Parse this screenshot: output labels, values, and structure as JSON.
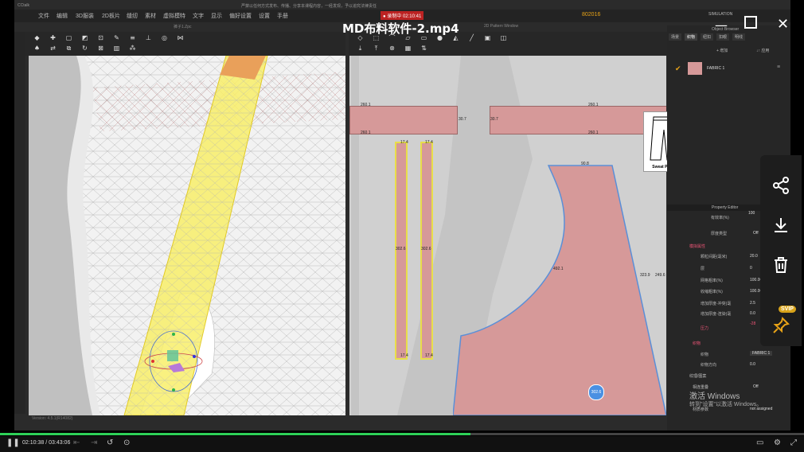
{
  "video": {
    "title": "MD布料软件-2.mp4",
    "record": "● 录制中 02:10:41",
    "brand": "CCtalk",
    "time": "02:10:38 / 03:43:06",
    "progress": 0.585
  },
  "menu": [
    "文件",
    "编辑",
    "3D服装",
    "2D板片",
    "缝纫",
    "素材",
    "虚拟模特",
    "文字",
    "显示",
    "偏好设置",
    "设置",
    "手册"
  ],
  "app": {
    "notice": "严禁以任何方式发布、传播、分享本课程内容，一经发现，予以追究法律责任",
    "sim_label": "SIMULATION",
    "badge": "802016",
    "view3d_title": "裤子1.Zpc",
    "view2d_title": "2D Pattern Window",
    "status_left": "Version: 4.5.1(R14082)"
  },
  "panel": {
    "title": "Object Browser",
    "tabs": [
      "场景",
      "织物",
      "纽扣",
      "扣眼",
      "明线"
    ],
    "add_label": "+ 增加",
    "sort_label": "↓↑ 应用",
    "fabric_name": "FABRIC 1",
    "prop_title": "Property Editor",
    "props": [
      {
        "label": "有效率(%)",
        "value": "100"
      },
      {
        "label": "厚度类型",
        "value": "Off"
      },
      {
        "label": "颗粒间距(毫米)",
        "value": "20.0"
      },
      {
        "label": "层",
        "value": "0"
      },
      {
        "label": "网格粗率(%)",
        "value": "100.00"
      },
      {
        "label": "收缩粗率(%)",
        "value": "100.00"
      },
      {
        "label": "增加厚度-冲突(毫",
        "value": "2.5"
      },
      {
        "label": "增加厚度-渲染(毫",
        "value": "0.0"
      }
    ],
    "sections": [
      "模拟属性",
      "压力",
      "织物",
      "纹理/图案"
    ],
    "pressure_value": "-28",
    "fabric_select": "FABRIC 1",
    "fabric_dir_label": "织物方向",
    "fabric_dir_value": "0.0",
    "fabric_label": "织物",
    "lock_label": "相连重叠",
    "lock_value": "Off",
    "material_label": "材质参数",
    "material_value": "not assigned"
  },
  "pattern": {
    "top_left": "260.1",
    "top_right": "260.1",
    "mid_left": "30.7",
    "mid_right": "30.7",
    "bottom_left": "260.1",
    "bottom_right": "260.1",
    "strip_top": "17.4",
    "strip_len": "302.6",
    "strip_len2": "302.6",
    "waist": "90.8",
    "curve": "492.1",
    "side": "323.9",
    "side2": "249.6",
    "dot": "302.6",
    "sweat_pants": "Sweat Pants"
  },
  "watermark": {
    "line1": "激活 Windows",
    "line2": "转到\"设置\"以激活 Windows。"
  },
  "sidebar": {
    "svip": "SVIP"
  }
}
